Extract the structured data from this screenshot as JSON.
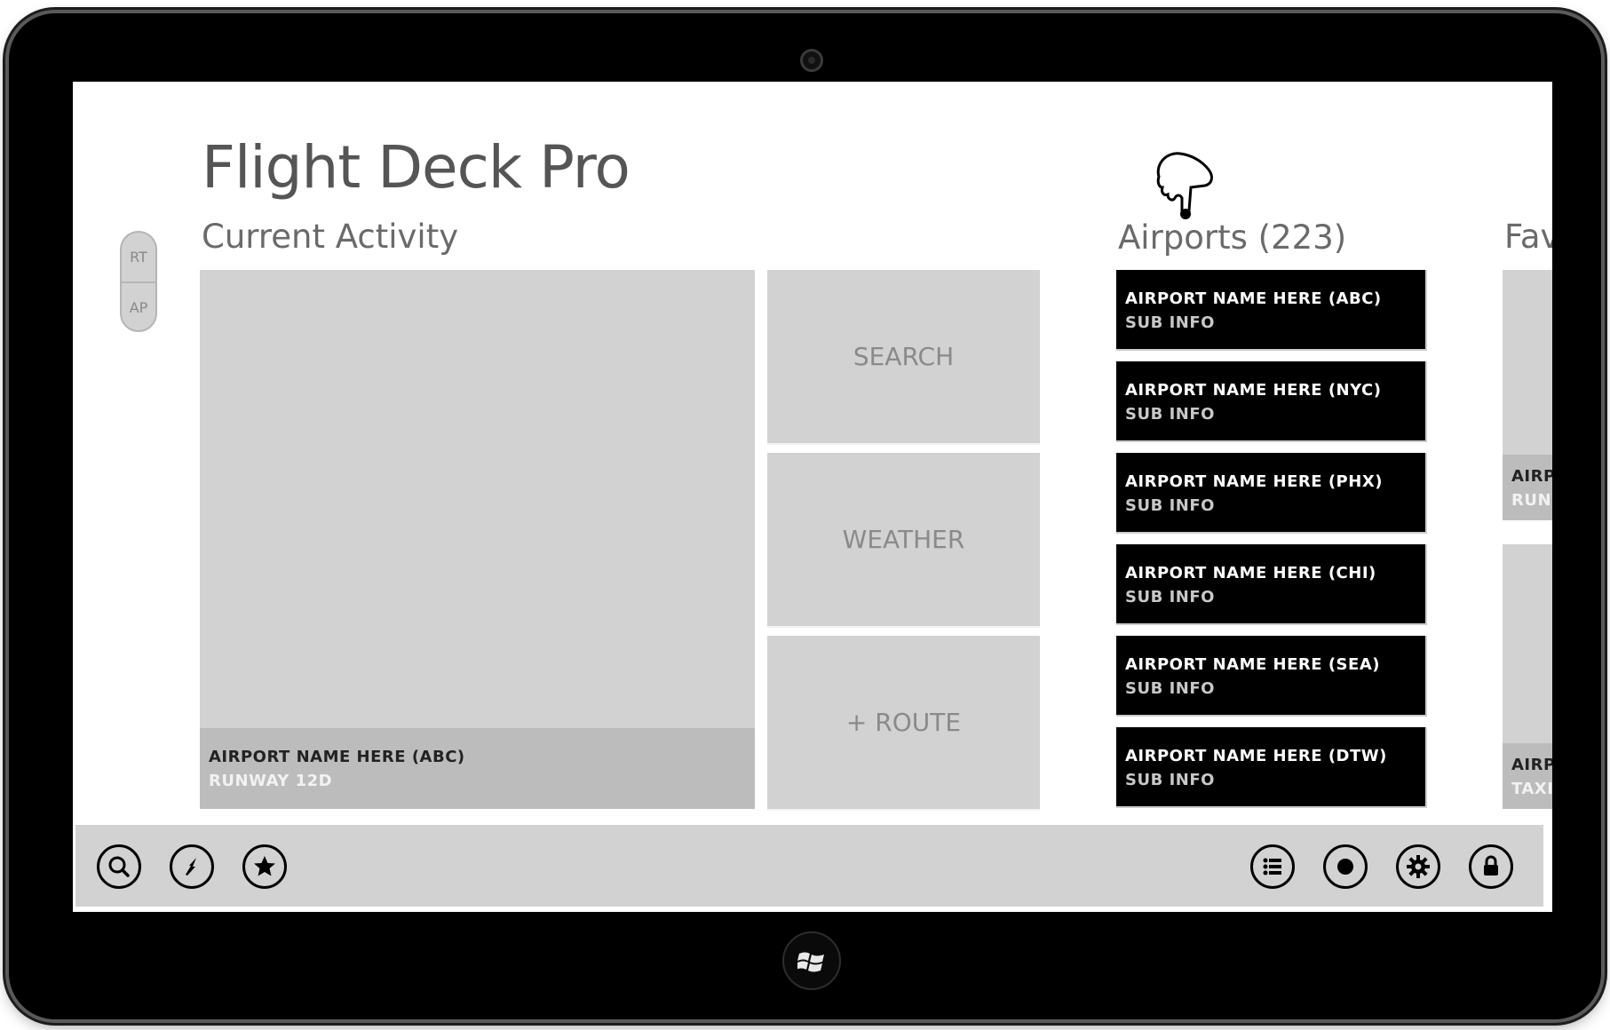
{
  "app": {
    "title": "Flight Deck Pro"
  },
  "toggle": {
    "top_label": "RT",
    "bottom_label": "AP"
  },
  "sections": {
    "current_activity": "Current Activity",
    "airports": "Airports (223)",
    "favorites": "Fav"
  },
  "current_activity": {
    "main_tile": {
      "title": "AIRPORT NAME HERE (ABC)",
      "subtitle": "RUNWAY 12D"
    },
    "actions": [
      {
        "label": "SEARCH"
      },
      {
        "label": "WEATHER"
      },
      {
        "label": "+ ROUTE"
      }
    ]
  },
  "airports": [
    {
      "name": "AIRPORT NAME HERE (ABC)",
      "sub": "SUB INFO"
    },
    {
      "name": "AIRPORT NAME HERE (NYC)",
      "sub": "SUB INFO"
    },
    {
      "name": "AIRPORT NAME HERE (PHX)",
      "sub": "SUB INFO"
    },
    {
      "name": "AIRPORT NAME HERE (CHI)",
      "sub": "SUB INFO"
    },
    {
      "name": "AIRPORT NAME HERE (SEA)",
      "sub": "SUB INFO"
    },
    {
      "name": "AIRPORT NAME HERE (DTW)",
      "sub": "SUB INFO"
    }
  ],
  "favorites": [
    {
      "title": "AIRP",
      "sub": "RUNW"
    },
    {
      "title": "AIRP",
      "sub": "TAXI"
    }
  ],
  "appbar": {
    "left_icons": [
      "search-icon",
      "bolt-icon",
      "star-icon"
    ],
    "right_icons": [
      "list-icon",
      "record-icon",
      "gear-icon",
      "lock-icon"
    ]
  },
  "colors": {
    "tile_gray": "#d2d2d2",
    "caption_gray": "#bcbcbc",
    "airport_tile": "#000000",
    "bezel": "#000000"
  }
}
